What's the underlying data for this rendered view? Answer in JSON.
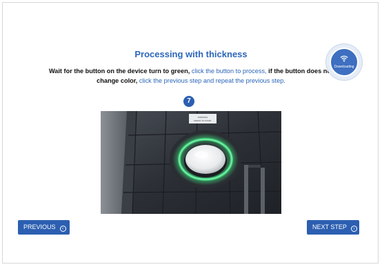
{
  "title": "Processing with thickness",
  "instructions": {
    "part1": "Wait for the button on the device turn to green, ",
    "link1": "click the button to process,",
    "part2": " if the button does not change color, ",
    "link2": "click the previous step and repeat the previous step."
  },
  "status": {
    "label": "Downloading",
    "icon": "wifi-icon"
  },
  "step_number": "7",
  "photo_label": {
    "line1": "WARNING",
    "line2": "PRESS TO START"
  },
  "buttons": {
    "previous": "PREVIOUS",
    "next": "NEXT STEP"
  },
  "colors": {
    "accent": "#2c5fb1",
    "title": "#2c66b8",
    "glow": "#3ed27a"
  }
}
